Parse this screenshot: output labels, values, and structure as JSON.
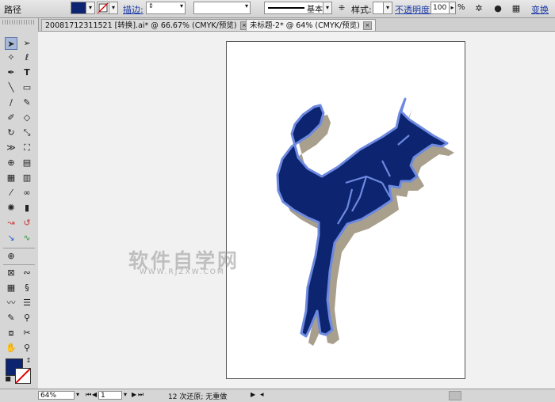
{
  "control_bar": {
    "object_label": "路径",
    "stroke_label": "描边:",
    "stroke_style": "基本",
    "style_label": "样式:",
    "opacity_label": "不透明度:",
    "opacity_value": "100",
    "opacity_unit": "%",
    "transform_label": "变换",
    "fill_color": "#0d2470"
  },
  "tabs": [
    {
      "label": "20081712311521 [转换].ai* @ 66.67% (CMYK/预览)",
      "close": "×"
    },
    {
      "label": "未标题-2* @ 64% (CMYK/预览)",
      "close": "×"
    }
  ],
  "tools": {
    "fill_color": "#0d2470"
  },
  "canvas": {
    "kangaroo_color": "#0d2470",
    "shadow_color": "#a89f8c",
    "outline_color": "#6d8ae0"
  },
  "watermark": {
    "main": "软件自学网",
    "sub": "WWW.RJZXW.COM"
  },
  "status_bar": {
    "zoom": "64%",
    "page": "1",
    "message": "12 次还原; 无重做"
  }
}
